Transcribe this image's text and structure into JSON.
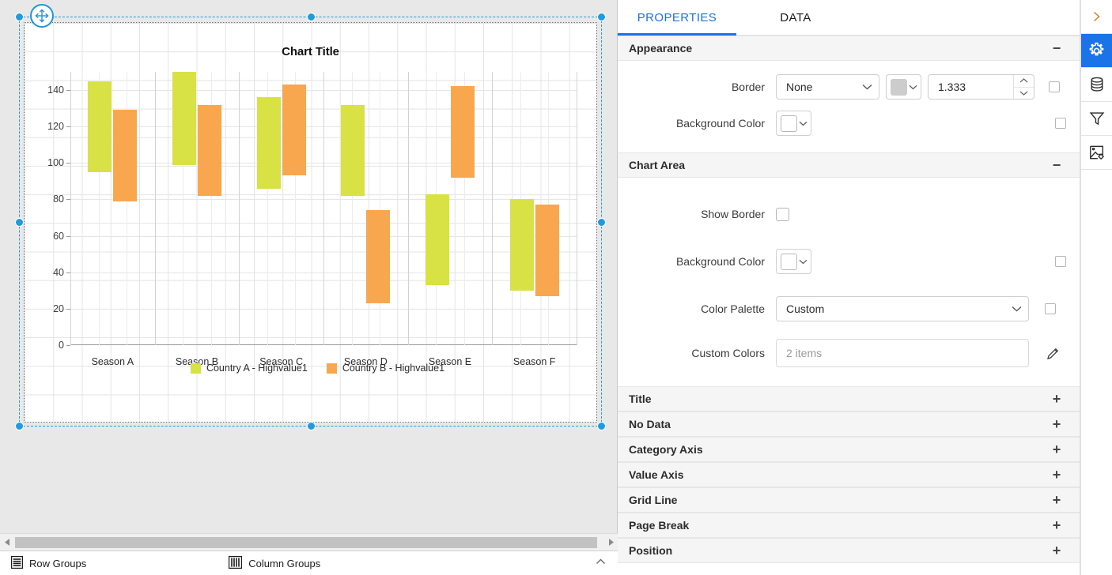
{
  "chart_data": {
    "type": "bar",
    "subtype": "range-bar",
    "title": "Chart Title",
    "xlabel": "",
    "ylabel": "",
    "ylim": [
      0,
      150
    ],
    "yticks": [
      0,
      20,
      40,
      60,
      80,
      100,
      120,
      140
    ],
    "grid": true,
    "legend_position": "bottom",
    "categories": [
      "Season A",
      "Season B",
      "Season C",
      "Season D",
      "Season E",
      "Season F"
    ],
    "series": [
      {
        "name": "Country A - Highvalue1",
        "color": "#d8e245",
        "low": [
          95,
          99,
          86,
          82,
          33,
          30
        ],
        "high": [
          145,
          150,
          136,
          132,
          83,
          80
        ]
      },
      {
        "name": "Country B - Highvalue1",
        "color": "#f9a74f",
        "low": [
          79,
          82,
          93,
          23,
          92,
          27
        ],
        "high": [
          129,
          132,
          143,
          74,
          142,
          77
        ]
      }
    ]
  },
  "canvas": {
    "move_handle_icon": "move-4-arrows-icon",
    "hscroll": {
      "left_arrow_icon": "triangle-left-icon",
      "right_arrow_icon": "triangle-right-icon"
    }
  },
  "statusbar": {
    "row_groups_label": "Row Groups",
    "row_groups_icon": "rows-icon",
    "column_groups_label": "Column Groups",
    "column_groups_icon": "columns-icon",
    "collapse_icon": "chevron-double-up-icon"
  },
  "panel": {
    "tabs": [
      {
        "label": "PROPERTIES",
        "active": true
      },
      {
        "label": "DATA",
        "active": false
      }
    ],
    "accent_color": "#1a73e8",
    "sections": {
      "appearance": {
        "title": "Appearance",
        "toggle_icon": "minus-icon",
        "border": {
          "label": "Border",
          "style_value": "None",
          "style_chevron_icon": "chevron-down-icon",
          "color_value": "#cccccc",
          "color_chevron_icon": "chevron-down-icon",
          "width_value": "1.333",
          "spin_up_icon": "chevron-up-icon",
          "spin_down_icon": "chevron-down-icon",
          "expression_checkbox_icon": "checkbox-unchecked-icon"
        },
        "background_color": {
          "label": "Background Color",
          "color_value": "#ffffff",
          "color_chevron_icon": "chevron-down-icon",
          "expression_checkbox_icon": "checkbox-unchecked-icon"
        }
      },
      "chart_area": {
        "title": "Chart Area",
        "toggle_icon": "minus-icon",
        "show_border": {
          "label": "Show Border",
          "checkbox_icon": "checkbox-unchecked-icon"
        },
        "background_color": {
          "label": "Background Color",
          "color_value": "#ffffff",
          "color_chevron_icon": "chevron-down-icon",
          "expression_checkbox_icon": "checkbox-unchecked-icon"
        },
        "color_palette": {
          "label": "Color Palette",
          "value": "Custom",
          "chevron_icon": "chevron-down-icon",
          "expression_checkbox_icon": "checkbox-unchecked-icon"
        },
        "custom_colors": {
          "label": "Custom Colors",
          "placeholder": "2 items",
          "edit_icon": "pencil-icon"
        }
      }
    },
    "collapsed_sections": [
      {
        "label": "Title",
        "toggle_icon": "plus-icon"
      },
      {
        "label": "No Data",
        "toggle_icon": "plus-icon"
      },
      {
        "label": "Category Axis",
        "toggle_icon": "plus-icon"
      },
      {
        "label": "Value Axis",
        "toggle_icon": "plus-icon"
      },
      {
        "label": "Grid Line",
        "toggle_icon": "plus-icon"
      },
      {
        "label": "Page Break",
        "toggle_icon": "plus-icon"
      },
      {
        "label": "Position",
        "toggle_icon": "plus-icon"
      }
    ],
    "rail": [
      {
        "name": "expand-panel",
        "icon": "chevron-right-icon",
        "active": false
      },
      {
        "name": "properties",
        "icon": "gear-icon",
        "active": true
      },
      {
        "name": "data-sources",
        "icon": "database-icon",
        "active": false
      },
      {
        "name": "filters",
        "icon": "funnel-icon",
        "active": false
      },
      {
        "name": "chart-settings",
        "icon": "image-settings-icon",
        "active": false
      }
    ]
  }
}
